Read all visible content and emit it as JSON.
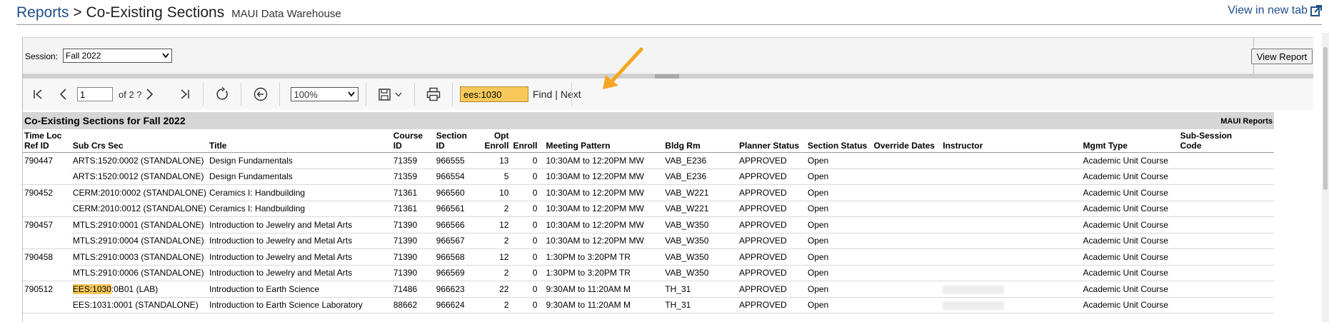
{
  "header": {
    "breadcrumb_root": "Reports",
    "separator": ">",
    "page_title": "Co-Existing Sections",
    "subtitle": "MAUI Data Warehouse",
    "new_tab_label": "View in new tab"
  },
  "params": {
    "session_label": "Session:",
    "session_value": "Fall 2022",
    "view_report_label": "View Report"
  },
  "toolbar": {
    "page_value": "1",
    "page_of": "of 2 ?",
    "zoom_value": "100%",
    "find_value": "ees:1030",
    "find_label": "Find",
    "find_sep": "|",
    "next_label": "Next"
  },
  "report": {
    "title": "Co-Existing Sections for Fall 2022",
    "brand": "MAUI Reports",
    "columns": {
      "ref1": "Time Loc",
      "ref2": "Ref ID",
      "sub": "Sub Crs Sec",
      "title": "Title",
      "course1": "Course",
      "course2": "ID",
      "section1": "Section",
      "section2": "ID",
      "opt1": "Opt",
      "opt2": "Enroll",
      "enroll": "Enroll",
      "meeting": "Meeting Pattern",
      "bldg": "Bldg Rm",
      "planner": "Planner Status",
      "status": "Section Status",
      "override": "Override Dates",
      "instructor": "Instructor",
      "mgmt": "Mgmt Type",
      "subsess1": "Sub-Session",
      "subsess2": "Code"
    },
    "rows": [
      {
        "ref": "790447",
        "sub": "ARTS:1520:0002 (STANDALONE)",
        "title": "Design Fundamentals",
        "course": "71359",
        "section": "966555",
        "opt": "13",
        "enroll": "0",
        "meeting": "10:30AM to 12:20PM MW",
        "bldg": "VAB_E236",
        "planner": "APPROVED",
        "status": "Open",
        "mgmt": "Academic Unit Course"
      },
      {
        "ref": "",
        "sub": "ARTS:1520:0012 (STANDALONE)",
        "title": "Design Fundamentals",
        "course": "71359",
        "section": "966554",
        "opt": "5",
        "enroll": "0",
        "meeting": "10:30AM to 12:20PM MW",
        "bldg": "VAB_E236",
        "planner": "APPROVED",
        "status": "Open",
        "mgmt": "Academic Unit Course"
      },
      {
        "ref": "790452",
        "sub": "CERM:2010:0002 (STANDALONE)",
        "title": "Ceramics I: Handbuilding",
        "course": "71361",
        "section": "966560",
        "opt": "10",
        "enroll": "0",
        "meeting": "10:30AM to 12:20PM MW",
        "bldg": "VAB_W221",
        "planner": "APPROVED",
        "status": "Open",
        "mgmt": "Academic Unit Course"
      },
      {
        "ref": "",
        "sub": "CERM:2010:0012 (STANDALONE)",
        "title": "Ceramics I: Handbuilding",
        "course": "71361",
        "section": "966561",
        "opt": "2",
        "enroll": "0",
        "meeting": "10:30AM to 12:20PM MW",
        "bldg": "VAB_W221",
        "planner": "APPROVED",
        "status": "Open",
        "mgmt": "Academic Unit Course"
      },
      {
        "ref": "790457",
        "sub": "MTLS:2910:0001 (STANDALONE)",
        "title": "Introduction to Jewelry and Metal Arts",
        "course": "71390",
        "section": "966566",
        "opt": "12",
        "enroll": "0",
        "meeting": "10:30AM to 12:20PM MW",
        "bldg": "VAB_W350",
        "planner": "APPROVED",
        "status": "Open",
        "mgmt": "Academic Unit Course"
      },
      {
        "ref": "",
        "sub": "MTLS:2910:0004 (STANDALONE)",
        "title": "Introduction to Jewelry and Metal Arts",
        "course": "71390",
        "section": "966567",
        "opt": "2",
        "enroll": "0",
        "meeting": "10:30AM to 12:20PM MW",
        "bldg": "VAB_W350",
        "planner": "APPROVED",
        "status": "Open",
        "mgmt": "Academic Unit Course"
      },
      {
        "ref": "790458",
        "sub": "MTLS:2910:0003 (STANDALONE)",
        "title": "Introduction to Jewelry and Metal Arts",
        "course": "71390",
        "section": "966568",
        "opt": "12",
        "enroll": "0",
        "meeting": "1:30PM to 3:20PM TR",
        "bldg": "VAB_W350",
        "planner": "APPROVED",
        "status": "Open",
        "mgmt": "Academic Unit Course"
      },
      {
        "ref": "",
        "sub": "MTLS:2910:0006 (STANDALONE)",
        "title": "Introduction to Jewelry and Metal Arts",
        "course": "71390",
        "section": "966569",
        "opt": "2",
        "enroll": "0",
        "meeting": "1:30PM to 3:20PM TR",
        "bldg": "VAB_W350",
        "planner": "APPROVED",
        "status": "Open",
        "mgmt": "Academic Unit Course"
      },
      {
        "ref": "790512",
        "sub_hl": "EES:1030",
        "sub_rest": ":0B01 (LAB)",
        "title": "Introduction to Earth Science",
        "course": "71486",
        "section": "966623",
        "opt": "22",
        "enroll": "0",
        "meeting": "9:30AM to 11:20AM M",
        "bldg": "TH_31",
        "planner": "APPROVED",
        "status": "Open",
        "mgmt": "Academic Unit Course"
      },
      {
        "ref": "",
        "sub": "EES:1031:0001 (STANDALONE)",
        "title": "Introduction to Earth Science Laboratory",
        "course": "88662",
        "section": "966624",
        "opt": "2",
        "enroll": "0",
        "meeting": "9:30AM to 11:20AM M",
        "bldg": "TH_31",
        "planner": "APPROVED",
        "status": "Open",
        "mgmt": "Academic Unit Course"
      }
    ]
  },
  "icons": [
    "first-page-icon",
    "prev-page-icon",
    "next-page-icon",
    "last-page-icon",
    "refresh-icon",
    "back-icon",
    "save-icon",
    "print-icon",
    "external-link-icon",
    "annotation-arrow-icon"
  ],
  "colors": {
    "accent": "#1f4e8a",
    "find_highlight": "#f8c95a",
    "annotation": "#f5a623"
  }
}
